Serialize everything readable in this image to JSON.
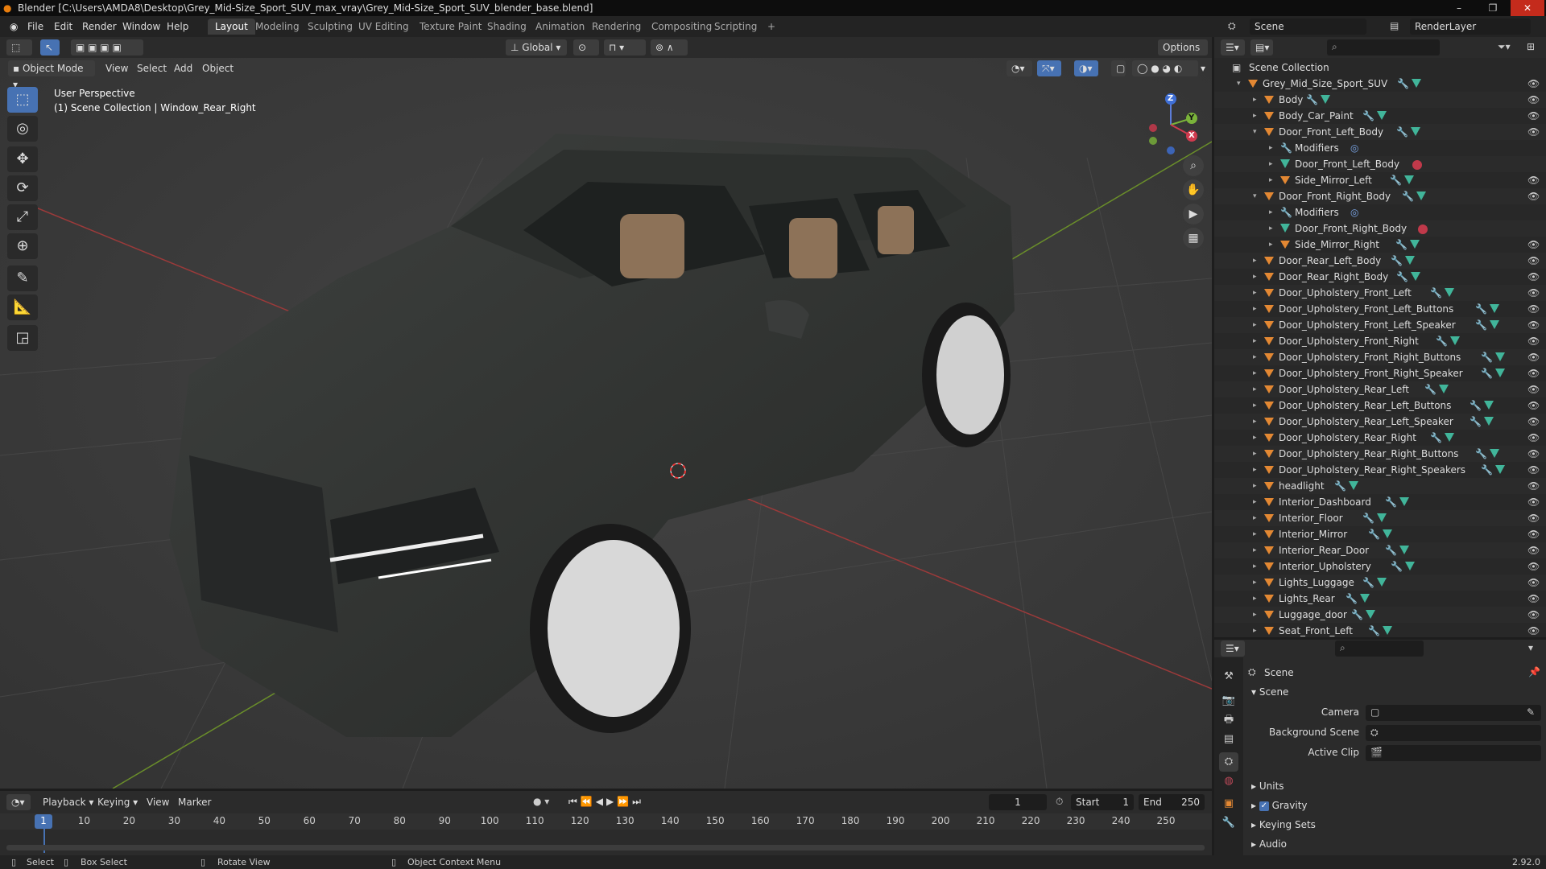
{
  "window": {
    "title": "Blender [C:\\Users\\AMDA8\\Desktop\\Grey_Mid-Size_Sport_SUV_max_vray\\Grey_Mid-Size_Sport_SUV_blender_base.blend]",
    "minimize": "–",
    "maximize": "❐",
    "close": "✕"
  },
  "menu": {
    "file": "File",
    "edit": "Edit",
    "render": "Render",
    "window": "Window",
    "help": "Help"
  },
  "workspaces": [
    "Layout",
    "Modeling",
    "Sculpting",
    "UV Editing",
    "Texture Paint",
    "Shading",
    "Animation",
    "Rendering",
    "Compositing",
    "Scripting"
  ],
  "add_workspace": "+",
  "top_right": {
    "scene": "Scene",
    "view_layer": "RenderLayer"
  },
  "viewport": {
    "header": {
      "mode": "Object Mode",
      "view": "View",
      "select": "Select",
      "add": "Add",
      "object": "Object",
      "transform": "Global",
      "options": "Options"
    },
    "overlay_line1": "User Perspective",
    "overlay_line2": "(1) Scene Collection | Window_Rear_Right",
    "gizmo": {
      "x": "X",
      "y": "Y",
      "z": "Z"
    }
  },
  "outliner": {
    "root": "Scene Collection",
    "rows": [
      {
        "label": "Grey_Mid_Size_Sport_SUV",
        "indent": 1,
        "arrow": "▾",
        "type": "object"
      },
      {
        "label": "Body",
        "indent": 2,
        "arrow": "▸",
        "type": "object"
      },
      {
        "label": "Body_Car_Paint",
        "indent": 2,
        "arrow": "▸",
        "type": "object"
      },
      {
        "label": "Door_Front_Left_Body",
        "indent": 2,
        "arrow": "▾",
        "type": "object"
      },
      {
        "label": "Modifiers",
        "indent": 3,
        "arrow": "▸",
        "type": "modifiers"
      },
      {
        "label": "Door_Front_Left_Body",
        "indent": 3,
        "arrow": "▸",
        "type": "mesh"
      },
      {
        "label": "Side_Mirror_Left",
        "indent": 3,
        "arrow": "▸",
        "type": "object"
      },
      {
        "label": "Door_Front_Right_Body",
        "indent": 2,
        "arrow": "▾",
        "type": "object"
      },
      {
        "label": "Modifiers",
        "indent": 3,
        "arrow": "▸",
        "type": "modifiers"
      },
      {
        "label": "Door_Front_Right_Body",
        "indent": 3,
        "arrow": "▸",
        "type": "mesh"
      },
      {
        "label": "Side_Mirror_Right",
        "indent": 3,
        "arrow": "▸",
        "type": "object"
      },
      {
        "label": "Door_Rear_Left_Body",
        "indent": 2,
        "arrow": "▸",
        "type": "object"
      },
      {
        "label": "Door_Rear_Right_Body",
        "indent": 2,
        "arrow": "▸",
        "type": "object"
      },
      {
        "label": "Door_Upholstery_Front_Left",
        "indent": 2,
        "arrow": "▸",
        "type": "object"
      },
      {
        "label": "Door_Upholstery_Front_Left_Buttons",
        "indent": 2,
        "arrow": "▸",
        "type": "object"
      },
      {
        "label": "Door_Upholstery_Front_Left_Speaker",
        "indent": 2,
        "arrow": "▸",
        "type": "object"
      },
      {
        "label": "Door_Upholstery_Front_Right",
        "indent": 2,
        "arrow": "▸",
        "type": "object"
      },
      {
        "label": "Door_Upholstery_Front_Right_Buttons",
        "indent": 2,
        "arrow": "▸",
        "type": "object"
      },
      {
        "label": "Door_Upholstery_Front_Right_Speaker",
        "indent": 2,
        "arrow": "▸",
        "type": "object"
      },
      {
        "label": "Door_Upholstery_Rear_Left",
        "indent": 2,
        "arrow": "▸",
        "type": "object"
      },
      {
        "label": "Door_Upholstery_Rear_Left_Buttons",
        "indent": 2,
        "arrow": "▸",
        "type": "object"
      },
      {
        "label": "Door_Upholstery_Rear_Left_Speaker",
        "indent": 2,
        "arrow": "▸",
        "type": "object"
      },
      {
        "label": "Door_Upholstery_Rear_Right",
        "indent": 2,
        "arrow": "▸",
        "type": "object"
      },
      {
        "label": "Door_Upholstery_Rear_Right_Buttons",
        "indent": 2,
        "arrow": "▸",
        "type": "object"
      },
      {
        "label": "Door_Upholstery_Rear_Right_Speakers",
        "indent": 2,
        "arrow": "▸",
        "type": "object"
      },
      {
        "label": "headlight",
        "indent": 2,
        "arrow": "▸",
        "type": "object"
      },
      {
        "label": "Interior_Dashboard",
        "indent": 2,
        "arrow": "▸",
        "type": "object"
      },
      {
        "label": "Interior_Floor",
        "indent": 2,
        "arrow": "▸",
        "type": "object"
      },
      {
        "label": "Interior_Mirror",
        "indent": 2,
        "arrow": "▸",
        "type": "object"
      },
      {
        "label": "Interior_Rear_Door",
        "indent": 2,
        "arrow": "▸",
        "type": "object"
      },
      {
        "label": "Interior_Upholstery",
        "indent": 2,
        "arrow": "▸",
        "type": "object"
      },
      {
        "label": "Lights_Luggage",
        "indent": 2,
        "arrow": "▸",
        "type": "object"
      },
      {
        "label": "Lights_Rear",
        "indent": 2,
        "arrow": "▸",
        "type": "object"
      },
      {
        "label": "Luggage_door",
        "indent": 2,
        "arrow": "▸",
        "type": "object"
      },
      {
        "label": "Seat_Front_Left",
        "indent": 2,
        "arrow": "▸",
        "type": "object"
      }
    ]
  },
  "properties": {
    "context": "Scene",
    "panel_title": "Scene",
    "camera_label": "Camera",
    "background_scene_label": "Background Scene",
    "active_clip_label": "Active Clip",
    "units": "Units",
    "gravity": "Gravity",
    "keying_sets": "Keying Sets",
    "audio": "Audio",
    "version": "2.92.0"
  },
  "timeline": {
    "playback": "Playback",
    "keying": "Keying",
    "view": "View",
    "marker": "Marker",
    "current_frame": "1",
    "start_label": "Start",
    "start": "1",
    "end_label": "End",
    "end": "250",
    "ticks": [
      "1",
      "10",
      "20",
      "30",
      "40",
      "50",
      "60",
      "70",
      "80",
      "90",
      "100",
      "110",
      "120",
      "130",
      "140",
      "150",
      "160",
      "170",
      "180",
      "190",
      "200",
      "210",
      "220",
      "230",
      "240",
      "250"
    ]
  },
  "status": {
    "select": "Select",
    "box_select": "Box Select",
    "rotate": "Rotate View",
    "context_menu": "Object Context Menu"
  }
}
